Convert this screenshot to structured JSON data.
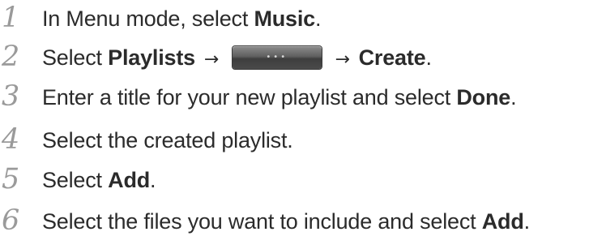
{
  "steps": [
    {
      "number": "1",
      "parts": [
        {
          "text": "In Menu mode, select ",
          "bold": false
        },
        {
          "text": "Music",
          "bold": true
        },
        {
          "text": ".",
          "bold": false
        }
      ]
    },
    {
      "number": "2",
      "parts": [
        {
          "text": "Select ",
          "bold": false
        },
        {
          "text": "Playlists",
          "bold": true
        },
        {
          "text": " → ",
          "bold": false,
          "arrow": true
        },
        {
          "button": "more-options",
          "label": "•••"
        },
        {
          "text": " → ",
          "bold": false,
          "arrow": true
        },
        {
          "text": "Create",
          "bold": true
        },
        {
          "text": ".",
          "bold": false
        }
      ]
    },
    {
      "number": "3",
      "parts": [
        {
          "text": "Enter a title for your new playlist and select ",
          "bold": false
        },
        {
          "text": "Done",
          "bold": true
        },
        {
          "text": ".",
          "bold": false
        }
      ]
    },
    {
      "number": "4",
      "parts": [
        {
          "text": "Select the created playlist.",
          "bold": false
        }
      ]
    },
    {
      "number": "5",
      "parts": [
        {
          "text": "Select ",
          "bold": false
        },
        {
          "text": "Add",
          "bold": true
        },
        {
          "text": ".",
          "bold": false
        }
      ]
    },
    {
      "number": "6",
      "parts": [
        {
          "text": "Select the files you want to include and select ",
          "bold": false
        },
        {
          "text": "Add",
          "bold": true
        },
        {
          "text": ".",
          "bold": false
        }
      ]
    }
  ],
  "colors": {
    "step_number": "#9a9a9a",
    "body_text": "#2b2b2b",
    "button_dark": "#4a4a4a",
    "button_dots": "#d8d8d8"
  },
  "icons": {
    "more_button": "more-options-icon"
  }
}
